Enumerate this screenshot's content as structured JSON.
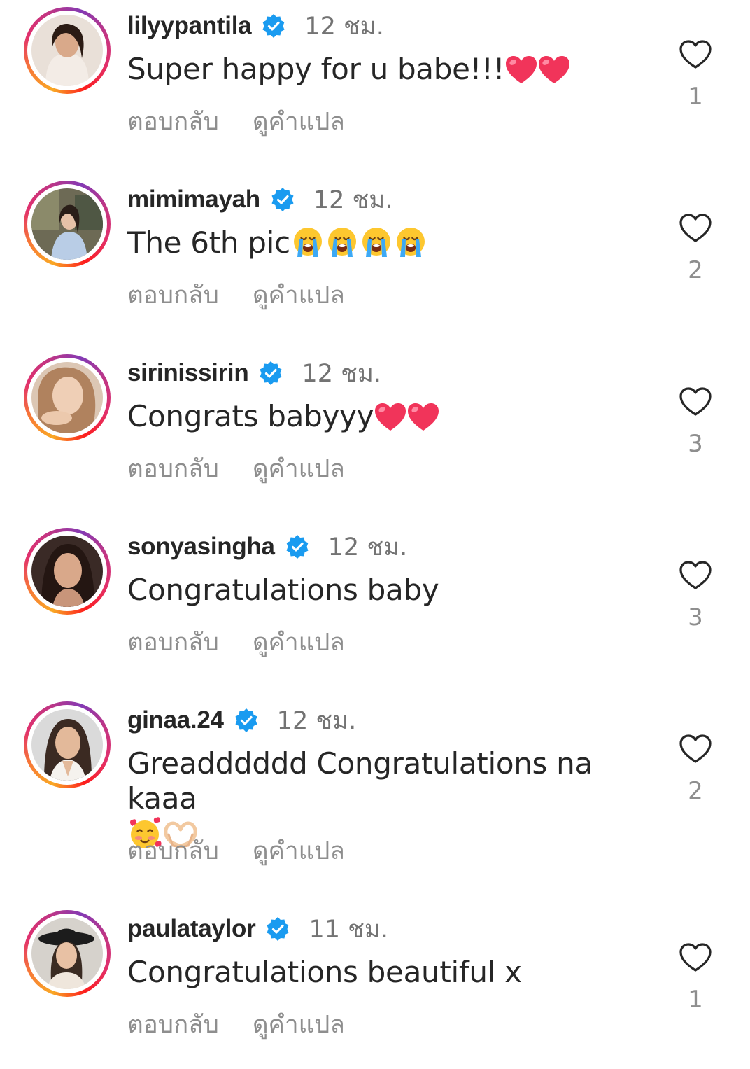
{
  "action_labels": {
    "reply": "ตอบกลับ",
    "translate": "ดูคำแปล"
  },
  "icons": {
    "verified": "verified-badge-icon",
    "like": "heart-outline-icon"
  },
  "colors": {
    "verified": "#1a9bf0",
    "muted": "#8e8e8e",
    "ring_start": "#f9a825",
    "ring_end": "#c13584"
  },
  "comments": [
    {
      "username": "lilyypantila",
      "time": "12 ชม.",
      "text": "Super happy for u babe!!!",
      "emojis": [
        "heart",
        "heart"
      ],
      "like_count": "1"
    },
    {
      "username": "mimimayah",
      "time": "12 ชม.",
      "text": "The 6th pic",
      "emojis": [
        "loudly-crying",
        "loudly-crying",
        "loudly-crying",
        "loudly-crying"
      ],
      "like_count": "2"
    },
    {
      "username": "sirinissirin",
      "time": "12 ชม.",
      "text": "Congrats babyyy",
      "emojis": [
        "heart",
        "heart"
      ],
      "like_count": "3"
    },
    {
      "username": "sonyasingha",
      "time": "12 ชม.",
      "text": "Congratulations baby",
      "emojis": [],
      "like_count": "3"
    },
    {
      "username": "ginaa.24",
      "time": "12 ชม.",
      "text": "Greadddddd Congratulations na kaaa",
      "emojis": [
        "smiling-face-with-hearts",
        "heart-hands"
      ],
      "like_count": "2"
    },
    {
      "username": "paulataylor",
      "time": "11 ชม.",
      "text": "Congratulations beautiful x",
      "emojis": [],
      "like_count": "1"
    }
  ]
}
